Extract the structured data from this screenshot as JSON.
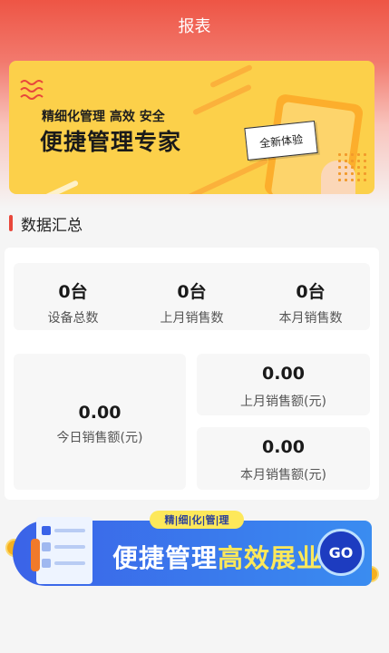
{
  "header": {
    "title": "报表"
  },
  "banner_top": {
    "subtitle": "精细化管理 高效 安全",
    "headline": "便捷管理专家",
    "tag": "全新体验"
  },
  "section": {
    "title": "数据汇总"
  },
  "stats": [
    {
      "value": "0台",
      "label": "设备总数"
    },
    {
      "value": "0台",
      "label": "上月销售数"
    },
    {
      "value": "0台",
      "label": "本月销售数"
    }
  ],
  "sales": {
    "today": {
      "value": "0.00",
      "label": "今日销售额(元)"
    },
    "last_month": {
      "value": "0.00",
      "label": "上月销售额(元)"
    },
    "this_month": {
      "value": "0.00",
      "label": "本月销售额(元)"
    }
  },
  "banner_bottom": {
    "pill": "精|细|化|管|理",
    "headline_part1": "便捷管理",
    "headline_part2": "高效展业",
    "go": "GO"
  },
  "colors": {
    "header_red": "#ee5545",
    "accent_red": "#e8473b",
    "banner_yellow": "#fcd04a",
    "banner_blue": "#3b63e8"
  }
}
